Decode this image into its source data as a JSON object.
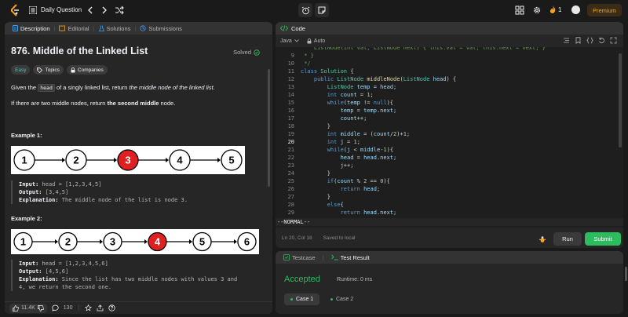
{
  "topbar": {
    "title": "Daily Question",
    "streak_count": "1",
    "premium_label": "Premium"
  },
  "left_tabs": [
    {
      "label": "Description",
      "active": true
    },
    {
      "label": "Editorial",
      "active": false
    },
    {
      "label": "Solutions",
      "active": false
    },
    {
      "label": "Submissions",
      "active": false
    }
  ],
  "problem": {
    "title": "876. Middle of the Linked List",
    "status": "Solved",
    "badges": {
      "difficulty": "Easy",
      "topics": "Topics",
      "companies": "Companies"
    },
    "desc1_pre": "Given the",
    "desc1_code": "head",
    "desc1_mid": "of a singly linked list, return",
    "desc1_em": "the middle node of the linked list",
    "desc1_end": ".",
    "desc2_pre": "If there are two middle nodes, return",
    "desc2_strong": "the second middle",
    "desc2_end": "node."
  },
  "example1": {
    "title": "Example 1:",
    "nodes": [
      "1",
      "2",
      "3",
      "4",
      "5"
    ],
    "highlight": 2,
    "input_label": "Input:",
    "input": "head = [1,2,3,4,5]",
    "output_label": "Output:",
    "output": "[3,4,5]",
    "explanation_label": "Explanation:",
    "explanation": "The middle node of the list is node 3."
  },
  "example2": {
    "title": "Example 2:",
    "nodes": [
      "1",
      "2",
      "3",
      "4",
      "5",
      "6"
    ],
    "highlight": 3,
    "input_label": "Input:",
    "input": "head = [1,2,3,4,5,6]",
    "output_label": "Output:",
    "output": "[4,5,6]",
    "explanation_label": "Explanation:",
    "explanation_l1": "Since the list has two middle nodes with values 3 and",
    "explanation_l2": "4, we return the second one."
  },
  "footer": {
    "likes": "11.4K",
    "comments": "130"
  },
  "code": {
    "tab_label": "Code",
    "language": "Java",
    "mode": "Auto",
    "vim_status": "--NORMAL--",
    "cursor_pos": "Ln 20, Col 18",
    "saved": "Saved to local",
    "run_label": "Run",
    "submit_label": "Submit",
    "lines": [
      {
        "n": "",
        "html": "<span class='cm'>    ListNode(int val, ListNode next) { this.val = val; this.next = next; }</span>"
      },
      {
        "n": "9",
        "html": "<span class='cm'> * }</span>"
      },
      {
        "n": "10",
        "html": "<span class='cm'> */</span>"
      },
      {
        "n": "11",
        "html": "<span class='kw'>class</span> <span class='ty'>Solution</span> {"
      },
      {
        "n": "12",
        "html": "    <span class='kw'>public</span> <span class='ty'>ListNode</span> <span class='fn'>middleNode</span>(<span class='ty'>ListNode</span> <span class='vr'>head</span>) {"
      },
      {
        "n": "13",
        "html": "        <span class='ty'>ListNode</span> <span class='vr'>temp</span> = <span class='vr'>head</span>;"
      },
      {
        "n": "14",
        "html": "        <span class='kw'>int</span> <span class='vr'>count</span> = <span class='nm'>1</span>;"
      },
      {
        "n": "15",
        "html": "        <span class='kw'>while</span>(<span class='vr'>temp</span> != <span class='kw'>null</span>){"
      },
      {
        "n": "16",
        "html": "            <span class='vr'>temp</span> = <span class='vr'>temp</span>.<span class='vr'>next</span>;"
      },
      {
        "n": "17",
        "html": "            <span class='vr'>count</span>++;"
      },
      {
        "n": "18",
        "html": "        }"
      },
      {
        "n": "19",
        "html": "        <span class='kw'>int</span> <span class='vr'>middle</span> = (<span class='vr'>count</span>/<span class='nm'>2</span>)+<span class='nm'>1</span>;"
      },
      {
        "n": "20",
        "html": "        <span class='kw'>int</span> <span class='vr'>j</span> = <span class='nm'>1</span>;",
        "current": true
      },
      {
        "n": "21",
        "html": "        <span class='kw'>while</span>(<span class='vr'>j</span> &lt; <span class='vr'>middle</span>-<span class='nm'>1</span>){"
      },
      {
        "n": "22",
        "html": "            <span class='vr'>head</span> = <span class='vr'>head</span>.<span class='vr'>next</span>;"
      },
      {
        "n": "23",
        "html": "            <span class='vr'>j</span>++;"
      },
      {
        "n": "24",
        "html": "        }"
      },
      {
        "n": "25",
        "html": "        <span class='kw'>if</span>(<span class='vr'>count</span> % <span class='nm'>2</span> == <span class='nm'>0</span>){"
      },
      {
        "n": "26",
        "html": "            <span class='kw'>return</span> <span class='vr'>head</span>;"
      },
      {
        "n": "27",
        "html": "        }"
      },
      {
        "n": "28",
        "html": "        <span class='kw'>else</span>{"
      },
      {
        "n": "29",
        "html": "            <span class='kw'>return</span> <span class='vr'>head</span>.<span class='vr'>next</span>;"
      }
    ]
  },
  "test": {
    "testcase_label": "Testcase",
    "result_label": "Test Result",
    "verdict": "Accepted",
    "runtime": "Runtime: 0 ms",
    "cases": [
      "Case 1",
      "Case 2"
    ]
  },
  "colors": {
    "accent": "#ffa116",
    "accepted": "#2cbb5d",
    "easy": "#46c6c2",
    "highlight_node": "#e02020"
  }
}
